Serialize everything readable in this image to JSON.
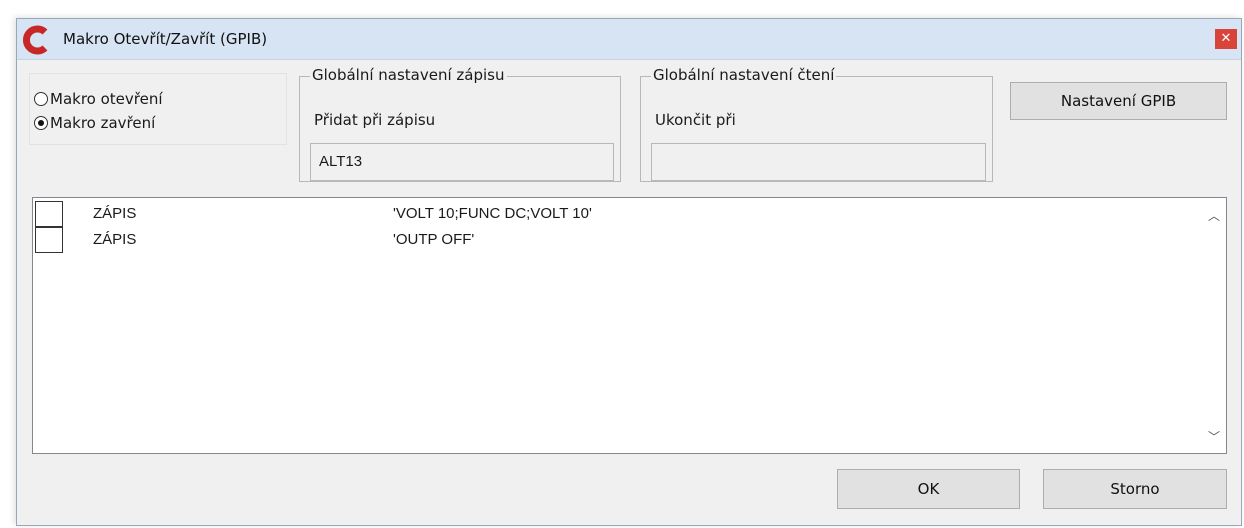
{
  "window": {
    "title": "Makro Otevřít/Zavřít (GPIB)",
    "close_glyph": "✕"
  },
  "radios": [
    {
      "label": "Makro otevření",
      "checked": false
    },
    {
      "label": "Makro zavření",
      "checked": true
    }
  ],
  "write_group": {
    "legend": "Globální nastavení zápisu",
    "label": "Přidat při zápisu",
    "value": "ALT13"
  },
  "read_group": {
    "legend": "Globální nastavení čtení",
    "label": "Ukončit při",
    "value": ""
  },
  "buttons": {
    "gpib": "Nastavení GPIB",
    "ok": "OK",
    "cancel": "Storno"
  },
  "list": {
    "rows": [
      {
        "command": "ZÁPIS",
        "value": "'VOLT 10;FUNC DC;VOLT 10'"
      },
      {
        "command": "ZÁPIS",
        "value": "'OUTP OFF'"
      }
    ],
    "scroll_up_glyph": "︿",
    "scroll_down_glyph": "﹀"
  },
  "icons": {
    "app": "app-logo-icon",
    "close": "close-icon"
  },
  "colors": {
    "titlebar": "#d6e4f4",
    "close": "#d8433a",
    "logo": "#c62828"
  }
}
